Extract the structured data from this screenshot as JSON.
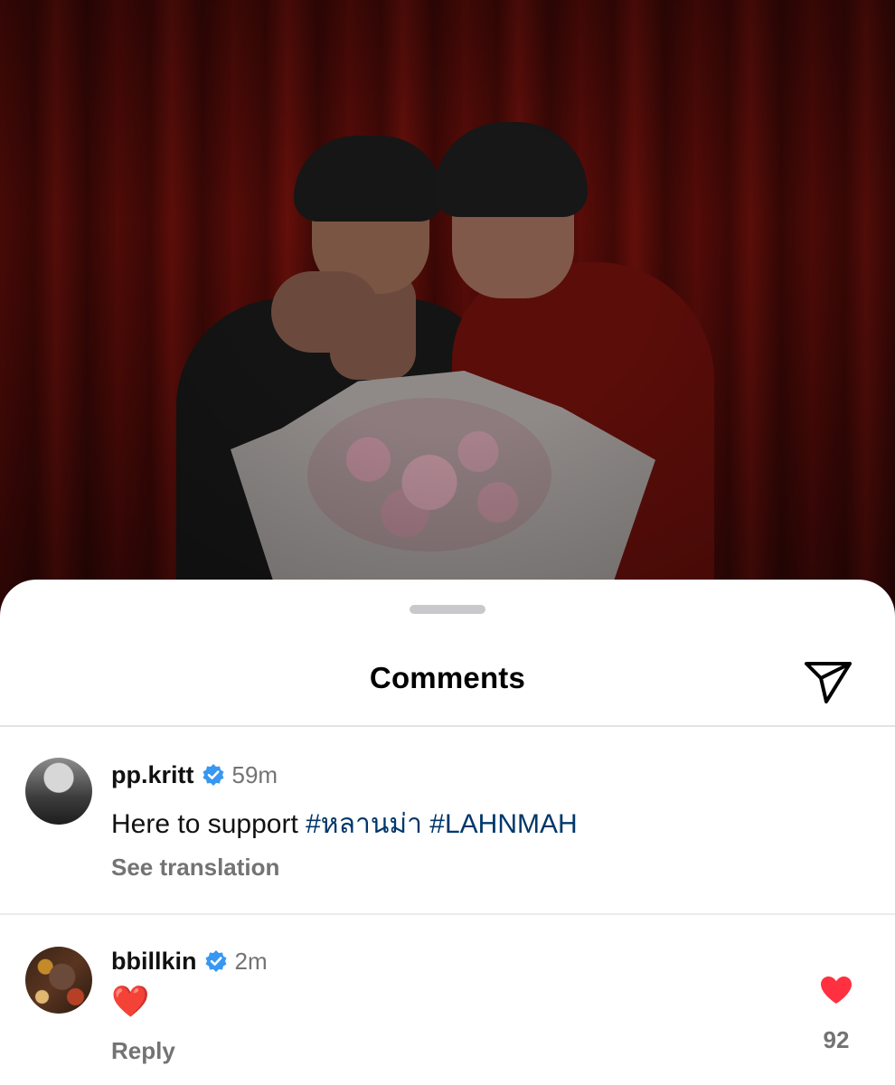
{
  "sheet": {
    "title": "Comments",
    "share_icon": "send-paper-plane-icon"
  },
  "comments": [
    {
      "username": "pp.kritt",
      "verified": true,
      "time": "59m",
      "text_plain": "Here to support ",
      "hashtags": [
        "#หลานม่า",
        "#LAHNMAH"
      ],
      "action": "See translation"
    },
    {
      "username": "bbillkin",
      "verified": true,
      "time": "2m",
      "text": "❤️",
      "action": "Reply",
      "like_icon": "heart-filled-icon",
      "like_count": "92"
    }
  ],
  "colors": {
    "verified_badge": "#3897f0",
    "hashtag": "#00376b",
    "like_heart": "#ff3040",
    "muted_text": "#737373"
  }
}
